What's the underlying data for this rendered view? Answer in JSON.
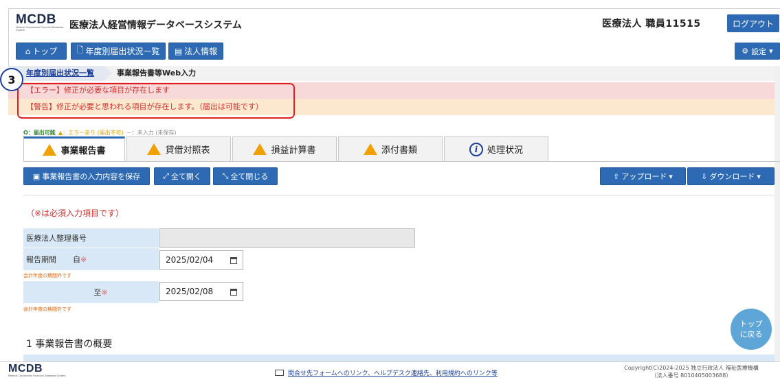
{
  "header": {
    "logo": "MCDB",
    "logo_sub": "Medical Corporation Financial Database System",
    "title": "医療法人経営情報データベースシステム",
    "user": "医療法人 職員11515",
    "logout": "ログアウト"
  },
  "nav": {
    "top": "トップ",
    "annual_status": "年度別届出状況一覧",
    "corp_info": "法人情報",
    "settings": "設定"
  },
  "breadcrumb": {
    "item1": "年度別届出状況一覧",
    "item2": "事業報告書等Web入力"
  },
  "alerts": {
    "error": "【エラー】修正が必要な項目が存在します",
    "warning": "【警告】修正が必要と思われる項目が存在します。（届出は可能です）"
  },
  "callout_number": "3",
  "legend": {
    "ok": "O：届出可能",
    "err": "▲：エラーあり (届出不可)",
    "none": "－：未入力 (未保存)"
  },
  "tabs": [
    {
      "label": "事業報告書",
      "status": "warning",
      "active": true
    },
    {
      "label": "貸借対照表",
      "status": "warning",
      "active": false
    },
    {
      "label": "損益計算書",
      "status": "warning",
      "active": false
    },
    {
      "label": "添付書類",
      "status": "warning",
      "active": false
    },
    {
      "label": "処理状況",
      "status": "info",
      "active": false
    }
  ],
  "toolbar": {
    "save": "事業報告書の入力内容を保存",
    "expand": "全て開く",
    "collapse": "全て閉じる",
    "upload": "アップロード",
    "download": "ダウンロード"
  },
  "required_note": "（※は必須入力項目です）",
  "form": {
    "corp_number_label": "医療法人整理番号",
    "corp_number_value": "",
    "period_label": "報告期間",
    "from_label": "自",
    "from_value": "2025/02/04",
    "from_note": "会計年度の期間外です",
    "to_label": "至",
    "to_value": "2025/02/08",
    "to_note": "会計年度の期間外です",
    "required_mark": "※"
  },
  "section_title": "1 事業報告書の概要",
  "back_to_top": "トップ\nに戻る",
  "footer": {
    "logo": "MCDB",
    "link": "問合せ先フォームへのリンク、ヘルプデスク連絡先、利用規約へのリンク等",
    "copyright_line1": "Copyright(C)2024-2025 独立行政法人 福祉医療機構",
    "copyright_line2": "（法人番号 8010405003688）"
  }
}
